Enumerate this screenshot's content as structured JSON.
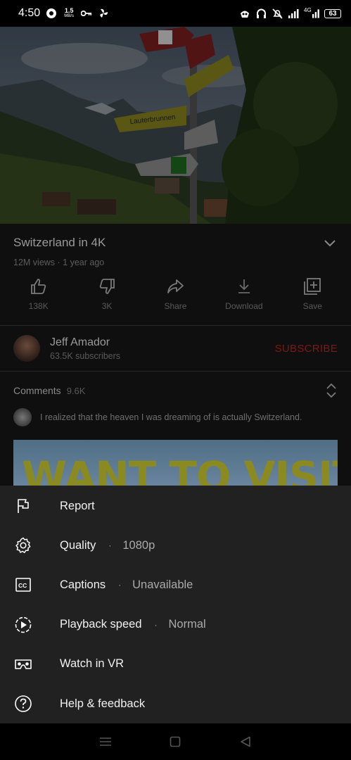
{
  "status_bar": {
    "time": "4:50",
    "data_speed": "1.5",
    "data_unit": "MB/s",
    "network": "4G",
    "battery": "63"
  },
  "video": {
    "sign_text": "Lauterbrunnen"
  },
  "details": {
    "title": "Switzerland in 4K",
    "meta": "12M views · 1 year ago",
    "actions": [
      {
        "label": "138K",
        "icon": "thumbs-up-icon"
      },
      {
        "label": "3K",
        "icon": "thumbs-down-icon"
      },
      {
        "label": "Share",
        "icon": "share-icon"
      },
      {
        "label": "Download",
        "icon": "download-icon"
      },
      {
        "label": "Save",
        "icon": "save-to-playlist-icon"
      }
    ],
    "channel": {
      "name": "Jeff Amador",
      "subscribers": "63.5K subscribers",
      "subscribe_label": "SUBSCRIBE"
    },
    "comments": {
      "title": "Comments",
      "count": "9.6K",
      "top_comment": "I realized that the heaven I was dreaming of is actually Switzerland."
    },
    "thumbnail_text": "WANT TO VISIT"
  },
  "menu": {
    "items": [
      {
        "label": "Report",
        "value": "",
        "icon": "flag-icon"
      },
      {
        "label": "Quality",
        "value": "1080p",
        "icon": "gear-icon"
      },
      {
        "label": "Captions",
        "value": "Unavailable",
        "icon": "closed-captions-icon"
      },
      {
        "label": "Playback speed",
        "value": "Normal",
        "icon": "playback-speed-icon"
      },
      {
        "label": "Watch in VR",
        "value": "",
        "icon": "vr-headset-icon"
      },
      {
        "label": "Help & feedback",
        "value": "",
        "icon": "help-icon"
      }
    ],
    "separator": "·"
  },
  "colors": {
    "sheet_bg": "#212121",
    "subscribe": "#cc0000",
    "status_bar": "#000000"
  }
}
